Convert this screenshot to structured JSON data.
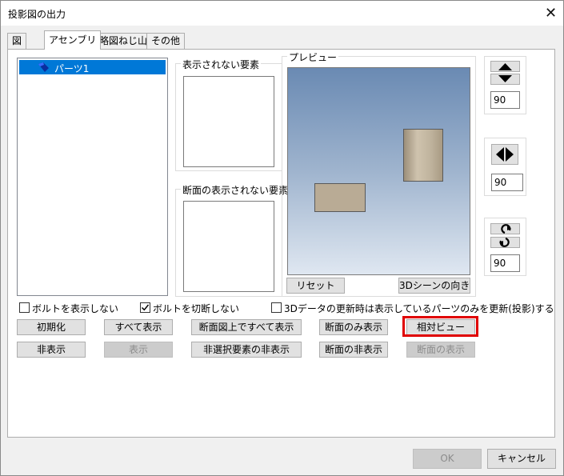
{
  "window": {
    "title": "投影図の出力"
  },
  "tabs": [
    "図",
    "アセンブリ",
    "略図ねじ山",
    "その他"
  ],
  "parts_list": {
    "items": [
      {
        "label": "パーツ1",
        "selected": true
      }
    ]
  },
  "groups": {
    "hidden_elements": "表示されない要素",
    "section_hidden_elements": "断面の表示されない要素",
    "preview": "プレビュー"
  },
  "preview_buttons": {
    "reset": "リセット",
    "scene_direction": "3Dシーンの向き"
  },
  "spinners": {
    "vertical": "90",
    "horizontal": "90",
    "rotate": "90"
  },
  "checkboxes": [
    {
      "label": "ボルトを表示しない",
      "checked": false
    },
    {
      "label": "ボルトを切断しない",
      "checked": true
    },
    {
      "label": "3Dデータの更新時は表示しているパーツのみを更新(投影)する",
      "checked": false
    }
  ],
  "buttons_row1": [
    "初期化",
    "すべて表示",
    "断面図上ですべて表示",
    "断面のみ表示",
    "相対ビュー"
  ],
  "buttons_row2": [
    "非表示",
    "表示",
    "非選択要素の非表示",
    "断面の非表示",
    "断面の表示"
  ],
  "footer": {
    "ok": "OK",
    "cancel": "キャンセル"
  },
  "colors": {
    "selection": "#0078d7",
    "highlight": "#e00000"
  }
}
